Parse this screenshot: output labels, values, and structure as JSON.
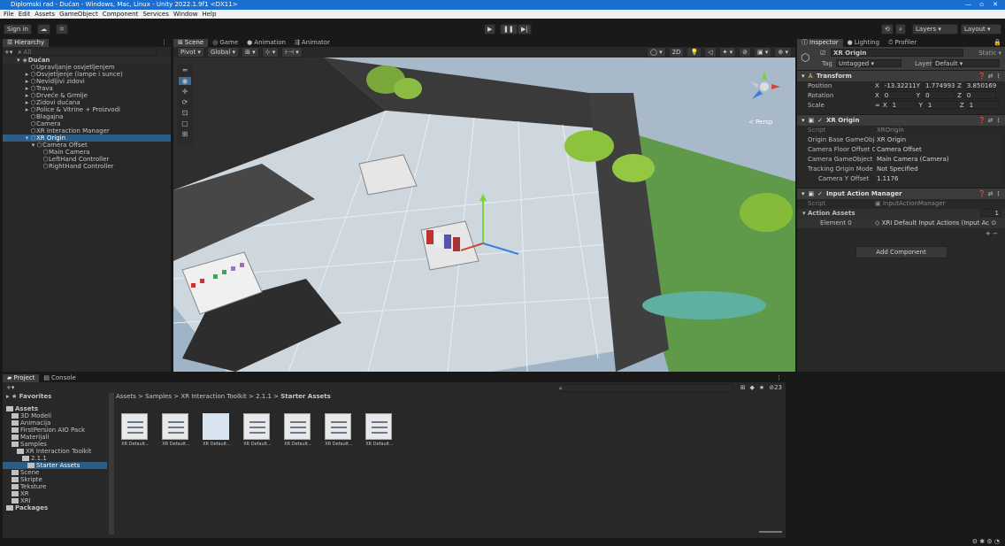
{
  "window": {
    "title": "Diplomski rad - Dućan - Windows, Mac, Linux - Unity 2022.1.9f1 <DX11>"
  },
  "menu": [
    "File",
    "Edit",
    "Assets",
    "GameObject",
    "Component",
    "Services",
    "Window",
    "Help"
  ],
  "toolbar": {
    "sign_in": "Sign in",
    "layers": "Layers",
    "layout": "Layout"
  },
  "hierarchy": {
    "tab": "Hierarchy",
    "search_placeholder": "All",
    "scene": "Dućan",
    "items": [
      {
        "label": "Upravljanje osvjetljenjem",
        "depth": 2,
        "fold": false,
        "selected": false
      },
      {
        "label": "Osvjetljenje (lampe i sunce)",
        "depth": 2,
        "fold": true,
        "selected": false
      },
      {
        "label": "Nevidljivi zidovi",
        "depth": 2,
        "fold": true,
        "selected": false
      },
      {
        "label": "Trava",
        "depth": 2,
        "fold": true,
        "selected": false
      },
      {
        "label": "Drveće & Grmlje",
        "depth": 2,
        "fold": true,
        "selected": false
      },
      {
        "label": "Zidovi dućana",
        "depth": 2,
        "fold": true,
        "selected": false
      },
      {
        "label": "Police & Vitrine + Proizvodi",
        "depth": 2,
        "fold": true,
        "selected": false
      },
      {
        "label": "Blagajna",
        "depth": 2,
        "fold": false,
        "selected": false
      },
      {
        "label": "Camera",
        "depth": 2,
        "fold": false,
        "selected": false
      },
      {
        "label": "XR Interaction Manager",
        "depth": 2,
        "fold": false,
        "selected": false
      },
      {
        "label": "XR Origin",
        "depth": 2,
        "fold": true,
        "selected": true
      },
      {
        "label": "Camera Offset",
        "depth": 3,
        "fold": true,
        "selected": false
      },
      {
        "label": "Main Camera",
        "depth": 4,
        "fold": false,
        "selected": false
      },
      {
        "label": "LeftHand Controller",
        "depth": 4,
        "fold": false,
        "selected": false
      },
      {
        "label": "RightHand Controller",
        "depth": 4,
        "fold": false,
        "selected": false
      }
    ]
  },
  "scene_tabs": [
    "Scene",
    "Game",
    "Animation",
    "Animator"
  ],
  "scene_toolbar": {
    "pivot": "Pivot",
    "global": "Global",
    "mode_2d": "2D"
  },
  "scene_gizmo_label": "< Persp",
  "inspector": {
    "tabs": [
      "Inspector",
      "Lighting",
      "Profiler"
    ],
    "object_name": "XR Origin",
    "static": "Static",
    "tag_label": "Tag",
    "tag": "Untagged",
    "layer_label": "Layer",
    "layer": "Default",
    "transform": {
      "title": "Transform",
      "position": {
        "label": "Position",
        "x": "-13.32211",
        "y": "1.774993",
        "z": "3.850169"
      },
      "rotation": {
        "label": "Rotation",
        "x": "0",
        "y": "0",
        "z": "0"
      },
      "scale": {
        "label": "Scale",
        "x": "1",
        "y": "1",
        "z": "1"
      }
    },
    "xr_origin": {
      "title": "XR Origin",
      "rows": [
        {
          "label": "Script",
          "value": "XROrigin"
        },
        {
          "label": "Origin Base GameObject",
          "value": "XR Origin"
        },
        {
          "label": "Camera Floor Offset Obje",
          "value": "Camera Offset"
        },
        {
          "label": "Camera GameObject",
          "value": "Main Camera (Camera)"
        },
        {
          "label": "Tracking Origin Mode",
          "value": "Not Specified"
        },
        {
          "label": "Camera Y Offset",
          "value": "1.1176"
        }
      ]
    },
    "input_action_manager": {
      "title": "Input Action Manager",
      "script_label": "Script",
      "script_value": "InputActionManager",
      "assets_label": "Action Assets",
      "assets_count": "1",
      "element_label": "Element 0",
      "element_value": "XRI Default Input Actions (Input Ac"
    },
    "add_component": "Add Component"
  },
  "project": {
    "tabs": [
      "Project",
      "Console"
    ],
    "favorites": "Favorites",
    "tree": [
      {
        "label": "Assets",
        "depth": 0,
        "bold": true,
        "selected": false
      },
      {
        "label": "3D Modeli",
        "depth": 1,
        "bold": false,
        "selected": false
      },
      {
        "label": "Animacija",
        "depth": 1,
        "bold": false,
        "selected": false
      },
      {
        "label": "FirstPersion AIO Pack",
        "depth": 1,
        "bold": false,
        "selected": false
      },
      {
        "label": "Materijali",
        "depth": 1,
        "bold": false,
        "selected": false
      },
      {
        "label": "Samples",
        "depth": 1,
        "bold": false,
        "selected": false
      },
      {
        "label": "XR Interaction Toolkit",
        "depth": 2,
        "bold": false,
        "selected": false
      },
      {
        "label": "2.1.1",
        "depth": 3,
        "bold": false,
        "selected": false
      },
      {
        "label": "Starter Assets",
        "depth": 4,
        "bold": false,
        "selected": true
      },
      {
        "label": "Scene",
        "depth": 1,
        "bold": false,
        "selected": false
      },
      {
        "label": "Skripte",
        "depth": 1,
        "bold": false,
        "selected": false
      },
      {
        "label": "Teksture",
        "depth": 1,
        "bold": false,
        "selected": false
      },
      {
        "label": "XR",
        "depth": 1,
        "bold": false,
        "selected": false
      },
      {
        "label": "XRI",
        "depth": 1,
        "bold": false,
        "selected": false
      },
      {
        "label": "Packages",
        "depth": 0,
        "bold": true,
        "selected": false
      }
    ],
    "breadcrumb": [
      "Assets",
      "Samples",
      "XR Interaction Toolkit",
      "2.1.1",
      "Starter Assets"
    ],
    "count": "23",
    "assets": [
      "XR Default...",
      "XR Default...",
      "XR Default...",
      "XR Default...",
      "XR Default...",
      "XR Default...",
      "XR Default..."
    ]
  }
}
